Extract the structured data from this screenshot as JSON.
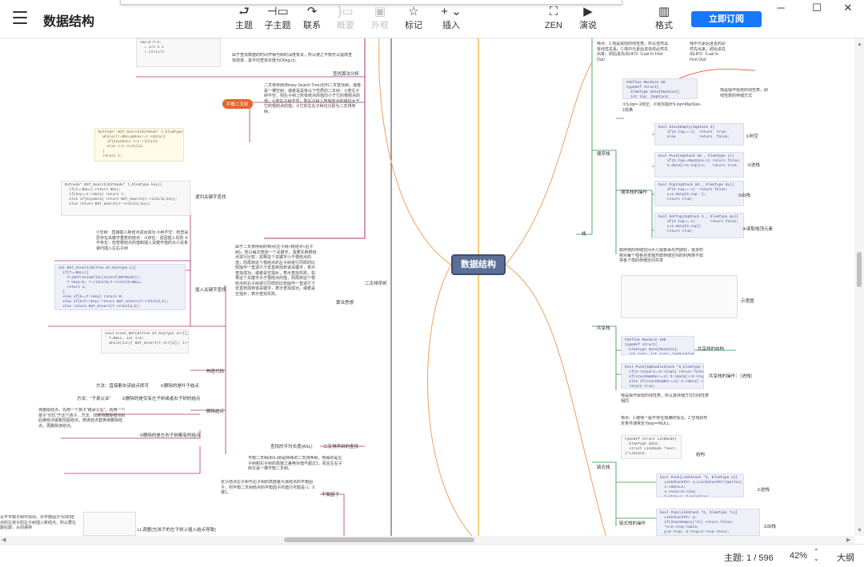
{
  "window": {
    "title": "数据结构",
    "controls": {
      "minimize": "─",
      "maximize": "☐",
      "close": "✕"
    }
  },
  "toolbar": {
    "tools": [
      {
        "label": "主题",
        "icon": "topic-icon",
        "glyph": "⮐",
        "disabled": false
      },
      {
        "label": "子主题",
        "icon": "subtopic-icon",
        "glyph": "⊣▭",
        "disabled": false
      },
      {
        "label": "联系",
        "icon": "relationship-icon",
        "glyph": "↷",
        "disabled": false
      },
      {
        "label": "概要",
        "icon": "summary-icon",
        "glyph": "}▭",
        "disabled": true
      },
      {
        "label": "外框",
        "icon": "boundary-icon",
        "glyph": "▣",
        "disabled": true
      },
      {
        "label": "标记",
        "icon": "marker-icon",
        "glyph": "☆",
        "disabled": false
      },
      {
        "label": "插入",
        "icon": "insert-icon",
        "glyph": "+ ⌄",
        "disabled": false
      },
      {
        "label": "ZEN",
        "icon": "zen-icon",
        "glyph": "⛶",
        "disabled": false
      },
      {
        "label": "演说",
        "icon": "pitch-icon",
        "glyph": "▶",
        "disabled": false
      },
      {
        "label": "格式",
        "icon": "format-icon",
        "glyph": "▥",
        "disabled": false
      }
    ],
    "subscribe_label": "立即订阅"
  },
  "mindmap": {
    "root": "数据结构",
    "accent_color": "#e8652a",
    "root_color": "#5a6e96",
    "left": {
      "top_notes": [
        "由于查找数据的时间开销与树的深度有关，所以使之平衡可以提高查找效率，其平均查找长度为O(log₂n)。",
        "二叉排序树(Binary Search Tree)也叫二叉查找树，或者是一棵空树，或者是具有以下性质的二叉树：①若左子树不空，则左子树上所有结点的值均小于它的根结点的值；②若右子树不空，则右子树上所有结点的值均大于它的根结点的值；③它的左右子树也分别为二叉排序树。"
      ],
      "badge": "平衡二叉树",
      "labels": [
        "查找算法分析",
        "递归关键字查找",
        "插入关键字查找",
        "构造代码",
        "删除结点",
        "二叉排序树",
        "算法思想",
        "平衡因子",
        "LL调整(左孩子的左子树上插入结点导致)"
      ],
      "delete_rules": [
        "方法：直接删去该结点即可",
        "方法：\"子承父业\"",
        "①删除的是叶子结点",
        "②删除的是仅有左子树或者右子树的结点",
        "③删除的是左右子树都有的结点"
      ],
      "insert_note": "①空树：直接插入新结点返回成功 ②树不空：检查是否存在关键字重复的结点：③存在：返回插入失败 ④不存在：检查根结点的值和插入关键字值的大小关系递归插入左右子树",
      "balance_note": "平衡二叉树(AVL)树是特殊的二叉排序树，特殊的是左子树和右子树的高度之差绝对值不超过1，而且左右子树又是一棵平衡二叉树。",
      "factor_note": "定义结点左子树与右子树的高度差为该结点的平衡因子，则平衡二叉树结点的平衡因子的值只可能是-1、0或1。"
    },
    "right": {
      "labels": [
        "栈",
        "顺序栈",
        "顺序栈的操作",
        "共享栈",
        "链式栈",
        "链式栈的操作",
        "①判空",
        "②进栈",
        "③出栈",
        "④读取栈顶元素",
        "共享栈的结构",
        "共享栈的操作：（进栈）",
        "①进栈",
        "②出栈",
        "结构"
      ],
      "stack_features": "特点：1.栈是受限的线性表，所以自然具有线性关系。2.栈中元素后进去的必然先出来，即后进先出LIFO（Last In First Out）",
      "shared_note": "顺序栈的存储空间大小需要事先开辟好，很多时候对每个栈各自单独开辟存储空间的利用率不如将各个栈的存储空间共享",
      "link_note": "栈是操作受限的线性表，所以其存储方式同线性表相同",
      "chain_note": "特点：1.链栈一般不存在栈满的情况。2.空栈的判定条件通常定为top==NULL;",
      "code_empty": "bool StackEmpty(SqStack S)\n    if(S.top==-1)  return  true;\n    else           return  false;",
      "code_push": "bool Push(SqStack &S , ElemType x){\n    if(S.top==MaxSize-1) return false;\n    S.data[++S.top]=x;   return true;",
      "code_pop": "bool Pop(SqStack &S , ElemType &x){\n    if(S.top==-1)  return false;\n    x=S.data[S.top--];\n    return true;",
      "code_top": "bool GetTop(SqStack S , ElemType &x){\n    if(S.top==-1)       return false;\n    x=S.data[S.top];\n    return true;"
    }
  },
  "statusbar": {
    "topic_label": "主题: 1 / 596",
    "zoom": "42%",
    "outline_label": "大纲"
  }
}
